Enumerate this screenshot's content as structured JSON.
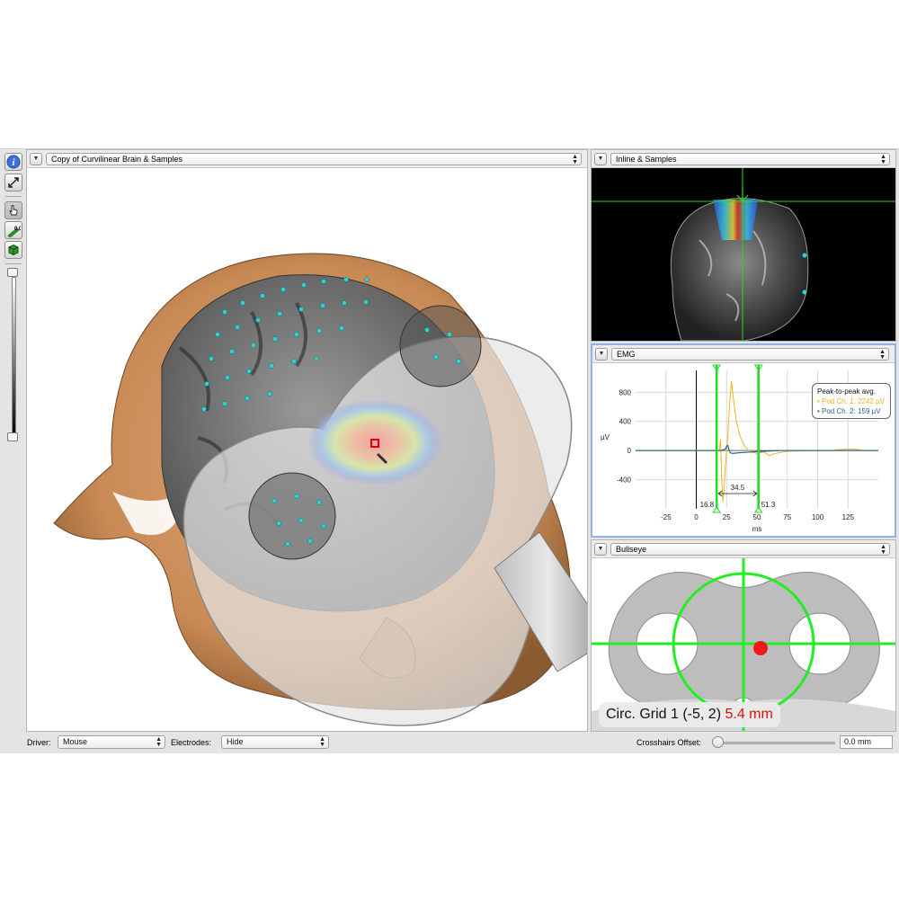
{
  "viewer3d": {
    "title": "Copy of Curvilinear Brain & Samples"
  },
  "inline": {
    "title": "Inline & Samples"
  },
  "emg": {
    "title": "EMG",
    "legend": {
      "title": "Peak-to-peak avg.",
      "ch1": "• Pod Ch. 1: 2242 µV",
      "ch2": "• Pod Ch. 2: 159 µV",
      "ch1_color": "#f2b21c",
      "ch2_color": "#1f6a8e"
    },
    "window_start_label": "16.8",
    "window_width_label": "34.5",
    "window_end_label": "51.3",
    "window_color": "#22dd22"
  },
  "chart_data": {
    "type": "line",
    "xlabel": "ms",
    "ylabel": "µV",
    "xlim": [
      -50,
      150
    ],
    "ylim": [
      -800,
      1100
    ],
    "x_ticks": [
      -25,
      0,
      25,
      50,
      75,
      100,
      125
    ],
    "y_ticks": [
      -400,
      0,
      400,
      800
    ],
    "window": [
      16.8,
      51.3
    ],
    "series": [
      {
        "name": "Pod Ch. 1",
        "color": "#f2b21c",
        "points": [
          [
            -50,
            0
          ],
          [
            15,
            0
          ],
          [
            19,
            0
          ],
          [
            20,
            150
          ],
          [
            21,
            -400
          ],
          [
            22,
            -700
          ],
          [
            23,
            -500
          ],
          [
            24,
            -200
          ],
          [
            25,
            0
          ],
          [
            26,
            200
          ],
          [
            27,
            500
          ],
          [
            28,
            750
          ],
          [
            29,
            950
          ],
          [
            30,
            800
          ],
          [
            31,
            650
          ],
          [
            33,
            400
          ],
          [
            36,
            200
          ],
          [
            40,
            50
          ],
          [
            45,
            -20
          ],
          [
            50,
            -40
          ],
          [
            56,
            -20
          ],
          [
            60,
            -70
          ],
          [
            65,
            -40
          ],
          [
            75,
            -10
          ],
          [
            100,
            0
          ],
          [
            112,
            0
          ],
          [
            115,
            10
          ],
          [
            130,
            20
          ],
          [
            140,
            0
          ],
          [
            150,
            0
          ]
        ]
      },
      {
        "name": "Pod Ch. 2",
        "color": "#1f6a8e",
        "points": [
          [
            -50,
            0
          ],
          [
            20,
            0
          ],
          [
            24,
            20
          ],
          [
            25,
            60
          ],
          [
            26,
            70
          ],
          [
            27,
            10
          ],
          [
            28,
            -30
          ],
          [
            30,
            -40
          ],
          [
            35,
            -30
          ],
          [
            45,
            -20
          ],
          [
            55,
            -10
          ],
          [
            70,
            0
          ],
          [
            150,
            0
          ]
        ]
      }
    ]
  },
  "bullseye": {
    "title": "Bullseye",
    "label_prefix": "Circ. Grid 1 (-5, 2)",
    "distance": "5.4 mm",
    "distance_color": "#e01010",
    "crosshair_color": "#22ee22"
  },
  "bottom": {
    "driver_label": "Driver:",
    "driver_value": "Mouse",
    "electrodes_label": "Electrodes:",
    "electrodes_value": "Hide",
    "offset_label": "Crosshairs Offset:",
    "offset_value": "0.0 mm"
  },
  "icons": {
    "info": "info-icon",
    "expand": "expand-icon",
    "pointer": "hand-pointer-icon",
    "ruler": "ruler-icon",
    "cube": "cube-icon"
  }
}
